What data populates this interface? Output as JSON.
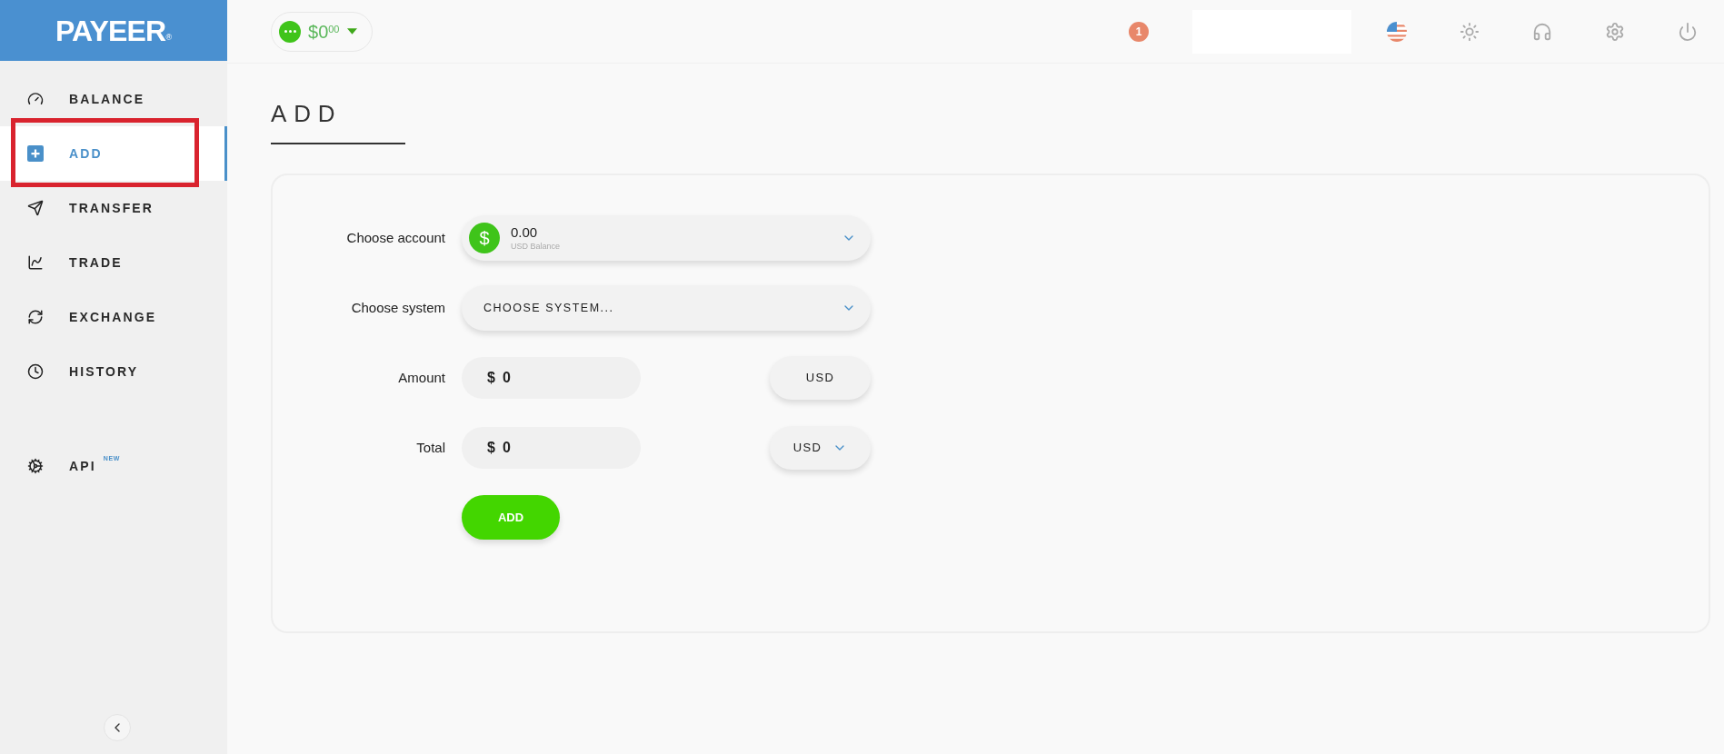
{
  "logo": {
    "text": "PAYEER",
    "mark": "®"
  },
  "sidebar": {
    "items": [
      {
        "label": "BALANCE",
        "selected": false
      },
      {
        "label": "ADD",
        "selected": true
      },
      {
        "label": "TRANSFER",
        "selected": false
      },
      {
        "label": "TRADE",
        "selected": false
      },
      {
        "label": "EXCHANGE",
        "selected": false
      },
      {
        "label": "HISTORY",
        "selected": false
      }
    ],
    "bottom_items": [
      {
        "label": "API",
        "badge": "NEW",
        "selected": false
      }
    ]
  },
  "balance_pill": {
    "currency": "$",
    "whole": "0",
    "cents": "00"
  },
  "notifications": {
    "count": "1"
  },
  "page": {
    "title": "ADD"
  },
  "form": {
    "account": {
      "label": "Choose account",
      "symbol": "$",
      "value": "0.00",
      "caption": "USD Balance"
    },
    "system": {
      "label": "Choose system",
      "value": "CHOOSE SYSTEM..."
    },
    "amounts": [
      {
        "label": "Amount",
        "symbol": "$",
        "value": "0",
        "currency": "USD",
        "dropdown": false
      },
      {
        "label": "Total",
        "symbol": "$",
        "value": "0",
        "currency": "USD",
        "dropdown": true
      }
    ],
    "submit": "ADD"
  }
}
